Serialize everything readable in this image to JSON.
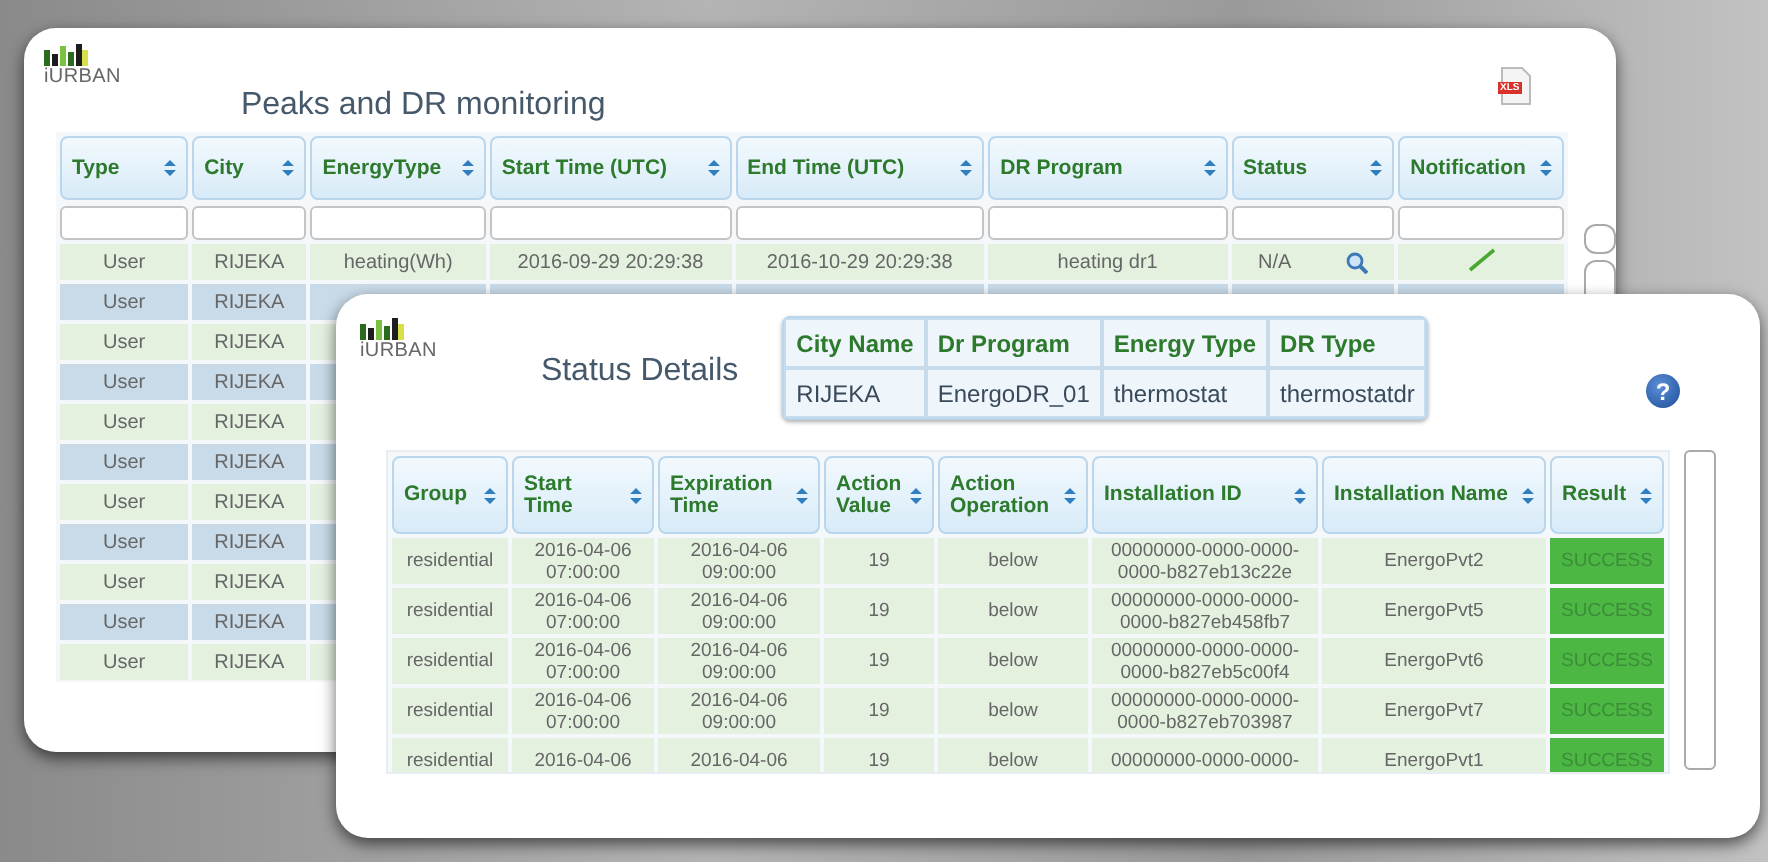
{
  "monitor_window": {
    "logo": "iURBAN",
    "title": "Peaks and DR monitoring",
    "export_label": "XLS",
    "columns": [
      "Type",
      "City",
      "EnergyType",
      "Start Time (UTC)",
      "End Time (UTC)",
      "DR Program",
      "Status",
      "Notification"
    ],
    "rows": [
      {
        "type": "User",
        "city": "RIJEKA",
        "energy_type": "heating(Wh)",
        "start_time": "2016-09-29 20:29:38",
        "end_time": "2016-10-29 20:29:38",
        "dr_program": "heating dr1",
        "status": "N/A"
      },
      {
        "type": "User",
        "city": "RIJEKA"
      },
      {
        "type": "User",
        "city": "RIJEKA"
      },
      {
        "type": "User",
        "city": "RIJEKA"
      },
      {
        "type": "User",
        "city": "RIJEKA"
      },
      {
        "type": "User",
        "city": "RIJEKA"
      },
      {
        "type": "User",
        "city": "RIJEKA"
      },
      {
        "type": "User",
        "city": "RIJEKA"
      },
      {
        "type": "User",
        "city": "RIJEKA"
      },
      {
        "type": "User",
        "city": "RIJEKA"
      },
      {
        "type": "User",
        "city": "RIJEKA"
      }
    ]
  },
  "status_dialog": {
    "logo": "iURBAN",
    "title": "Status Details",
    "help": "?",
    "summary": {
      "columns": [
        "City Name",
        "Dr Program",
        "Energy Type",
        "DR Type"
      ],
      "values": [
        "RIJEKA",
        "EnergoDR_01",
        "thermostat",
        "thermostatdr"
      ]
    },
    "columns": [
      "Group",
      "Start Time",
      "Expiration Time",
      "Action Value",
      "Action Operation",
      "Installation ID",
      "Installation Name",
      "Result"
    ],
    "rows": [
      {
        "group": "residential",
        "start_time": "2016-04-06 07:00:00",
        "expiration_time": "2016-04-06 09:00:00",
        "action_value": "19",
        "action_operation": "below",
        "installation_id": "00000000-0000-0000-0000-b827eb13c22e",
        "installation_name": "EnergoPvt2",
        "result": "SUCCESS"
      },
      {
        "group": "residential",
        "start_time": "2016-04-06 07:00:00",
        "expiration_time": "2016-04-06 09:00:00",
        "action_value": "19",
        "action_operation": "below",
        "installation_id": "00000000-0000-0000-0000-b827eb458fb7",
        "installation_name": "EnergoPvt5",
        "result": "SUCCESS"
      },
      {
        "group": "residential",
        "start_time": "2016-04-06 07:00:00",
        "expiration_time": "2016-04-06 09:00:00",
        "action_value": "19",
        "action_operation": "below",
        "installation_id": "00000000-0000-0000-0000-b827eb5c00f4",
        "installation_name": "EnergoPvt6",
        "result": "SUCCESS"
      },
      {
        "group": "residential",
        "start_time": "2016-04-06 07:00:00",
        "expiration_time": "2016-04-06 09:00:00",
        "action_value": "19",
        "action_operation": "below",
        "installation_id": "00000000-0000-0000-0000-b827eb703987",
        "installation_name": "EnergoPvt7",
        "result": "SUCCESS"
      },
      {
        "group": "residential",
        "start_time": "2016-04-06",
        "expiration_time": "2016-04-06",
        "action_value": "19",
        "action_operation": "below",
        "installation_id": "00000000-0000-0000-",
        "installation_name": "EnergoPvt1",
        "result": "SUCCESS"
      }
    ]
  }
}
